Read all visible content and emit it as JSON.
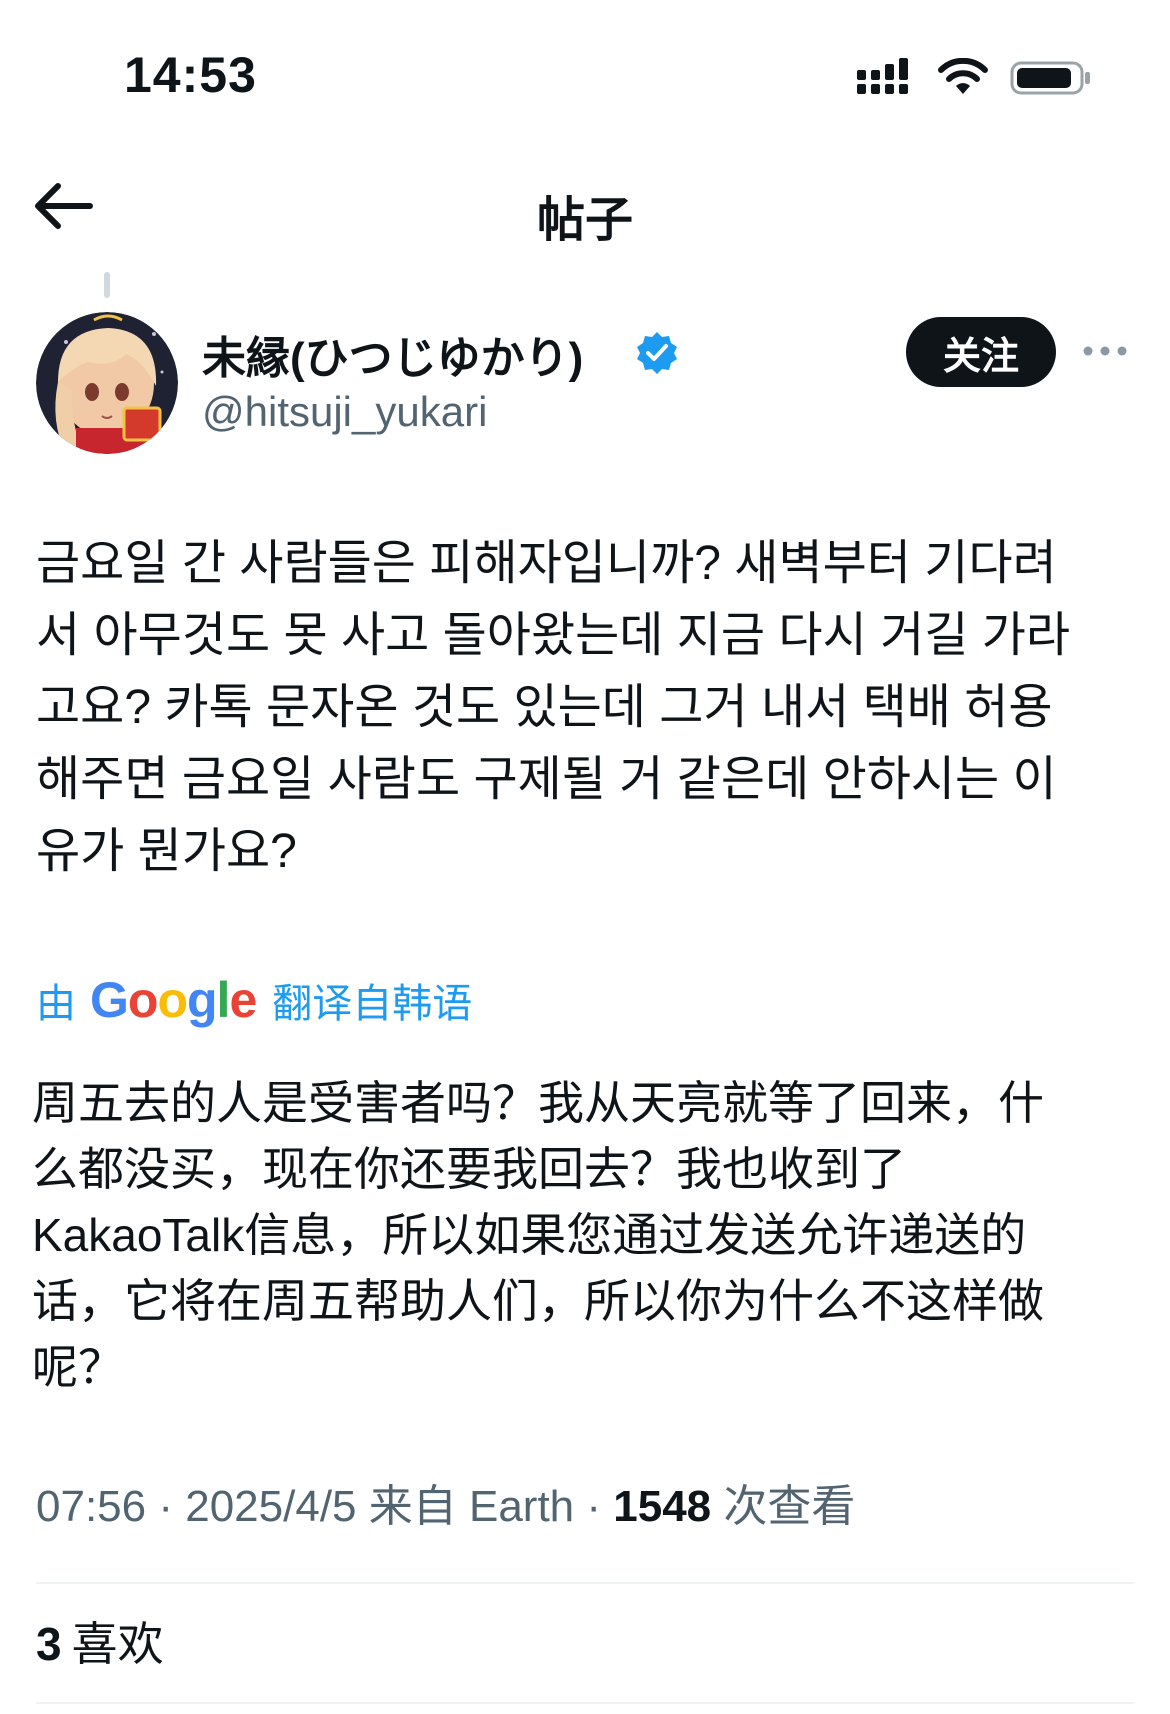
{
  "status_bar": {
    "time": "14:53",
    "icons": [
      "cellular-signal-icon",
      "wifi-icon",
      "battery-icon"
    ]
  },
  "nav": {
    "back_icon": "arrow-left-icon",
    "title": "帖子"
  },
  "author": {
    "display_name": "未縁(ひつじゆかり)",
    "handle": "@hitsuji_yukari",
    "verified": true,
    "follow_label": "关注",
    "more_icon": "more-horizontal-icon"
  },
  "tweet": {
    "text": "금요일 간 사람들은 피해자입니까? 새벽부터 기다려\n서 아무것도 못 사고 돌아왔는데 지금 다시 거길 가라\n고요? 카톡 문자온 것도 있는데 그거 내서 택배 허용\n해주면 금요일 사람도 구제될 거 같은데 안하시는 이\n유가 뭔가요?"
  },
  "translation": {
    "by_label": "由",
    "provider": "Google",
    "from_label": "翻译自韩语",
    "text": "周五去的人是受害者吗？我从天亮就等了回来，什\n么都没买，现在你还要我回去？我也收到了\nKakaoTalk信息，所以如果您通过发送允许递送的\n话，它将在周五帮助人们，所以你为什么不这样做\n呢？"
  },
  "meta": {
    "time": "07:56",
    "date": "2025/4/5",
    "source": "来自 Earth",
    "separator": "·",
    "views_count": "1548",
    "views_label": "次查看"
  },
  "engagement": {
    "likes_count": "3",
    "likes_label": "喜欢"
  },
  "colors": {
    "text": "#0f1419",
    "secondary": "#536471",
    "link": "#1d9bf0",
    "verified": "#1d9bf0",
    "divider": "#eff3f4"
  }
}
